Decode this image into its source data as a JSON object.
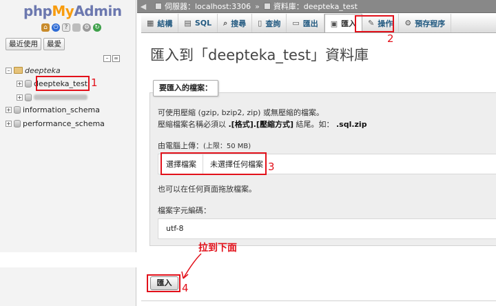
{
  "nav": {
    "logo_php": "php",
    "logo_my": "My",
    "logo_admin": "Admin",
    "recent_label": "最近使用",
    "favorites_label": "最愛",
    "tree": {
      "group_label": "deepteka",
      "db_selected": "deepteka_test",
      "db_information_schema": "information_schema",
      "db_performance_schema": "performance_schema"
    }
  },
  "breadcrumb": {
    "server_label": "伺服器：localhost:3306",
    "sep": "»",
    "db_label": "資料庫：deepteka_test"
  },
  "tabs": [
    {
      "label": "結構",
      "icon": "structure-icon"
    },
    {
      "label": "SQL",
      "icon": "sql-icon"
    },
    {
      "label": "搜尋",
      "icon": "search-icon"
    },
    {
      "label": "查詢",
      "icon": "query-icon"
    },
    {
      "label": "匯出",
      "icon": "export-icon"
    },
    {
      "label": "匯入",
      "icon": "import-icon"
    },
    {
      "label": "操作",
      "icon": "wrench-icon"
    },
    {
      "label": "預存程序",
      "icon": "routines-icon"
    }
  ],
  "main": {
    "title": "匯入到「deepteka_test」資料庫",
    "legend": "要匯入的檔案：",
    "compress_line1": "可使用壓縮 (gzip, bzip2, zip) 或無壓縮的檔案。",
    "compress_line2_pre": "壓縮檔案名稱必須以 ",
    "compress_line2_fmt": ".[格式].[壓縮方式]",
    "compress_line2_mid": " 結尾。如： ",
    "compress_line2_ex": ".sql.zip",
    "upload_label": "由電腦上傳：",
    "upload_limit": "(上限：50 MB)",
    "file_button": "選擇檔案",
    "file_status": "未選擇任何檔案",
    "dragdrop_text": "也可以在任何頁面拖放檔案。",
    "charset_label": "檔案字元編碼：",
    "charset_value": "utf-8",
    "import_button": "匯入"
  },
  "annotations": {
    "n1": "1",
    "n2": "2",
    "n3": "3",
    "n4": "4",
    "scroll_note": "拉到下面",
    "color": "#e2101a"
  },
  "colors": {
    "breadcrumb_bg": "#888888",
    "tab_text": "#235a81",
    "panel_bg": "#eeeeee"
  }
}
